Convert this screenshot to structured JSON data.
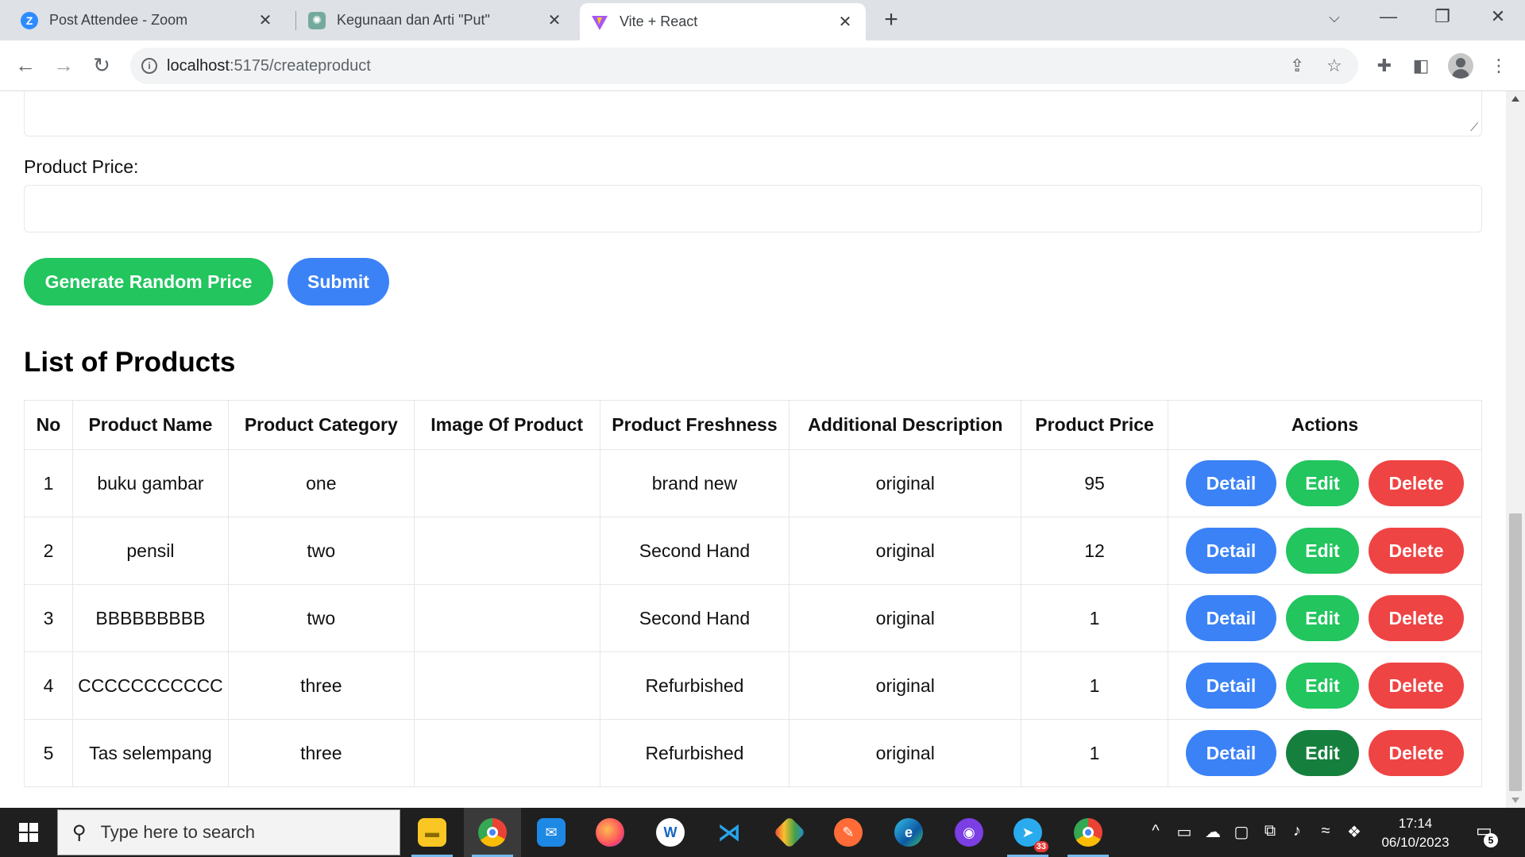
{
  "browser": {
    "tabs": [
      {
        "title": "Post Attendee - Zoom",
        "icon": "zoom-icon"
      },
      {
        "title": "Kegunaan dan Arti \"Put\"",
        "icon": "chatgpt-icon"
      },
      {
        "title": "Vite + React",
        "icon": "vite-icon",
        "active": true
      }
    ],
    "url_host": "localhost",
    "url_path": ":5175/createproduct"
  },
  "form": {
    "price_label": "Product Price:",
    "price_value": "",
    "random_price_button": "Generate Random Price",
    "submit_button": "Submit"
  },
  "list": {
    "title": "List of Products",
    "columns": [
      "No",
      "Product Name",
      "Product Category",
      "Image Of Product",
      "Product Freshness",
      "Additional Description",
      "Product Price",
      "Actions"
    ],
    "rows": [
      {
        "no": "1",
        "name": "buku gambar",
        "category": "one",
        "image": "",
        "freshness": "brand new",
        "description": "original",
        "price": "95"
      },
      {
        "no": "2",
        "name": "pensil",
        "category": "two",
        "image": "",
        "freshness": "Second Hand",
        "description": "original",
        "price": "12"
      },
      {
        "no": "3",
        "name": "BBBBBBBBB",
        "category": "two",
        "image": "",
        "freshness": "Second Hand",
        "description": "original",
        "price": "1"
      },
      {
        "no": "4",
        "name": "CCCCCCCCCCC",
        "category": "three",
        "image": "",
        "freshness": "Refurbished",
        "description": "original",
        "price": "1"
      },
      {
        "no": "5",
        "name": "Tas selempang",
        "category": "three",
        "image": "",
        "freshness": "Refurbished",
        "description": "original",
        "price": "1"
      }
    ],
    "actions": {
      "detail": "Detail",
      "edit": "Edit",
      "delete": "Delete"
    }
  },
  "colors": {
    "green": "#22c55e",
    "blue": "#3b82f6",
    "red": "#ef4444",
    "edit_hover": "#15803d"
  },
  "taskbar": {
    "search_placeholder": "Type here to search",
    "time": "17:14",
    "date": "06/10/2023",
    "telegram_badge": "33",
    "notification_count": "5",
    "apps": [
      "file-explorer-icon",
      "chrome-icon",
      "mail-icon",
      "firefox-icon",
      "app-icon",
      "vscode-icon",
      "git-icon",
      "postman-icon",
      "edge-icon",
      "github-desktop-icon",
      "telegram-icon",
      "chrome-profile-icon"
    ]
  }
}
